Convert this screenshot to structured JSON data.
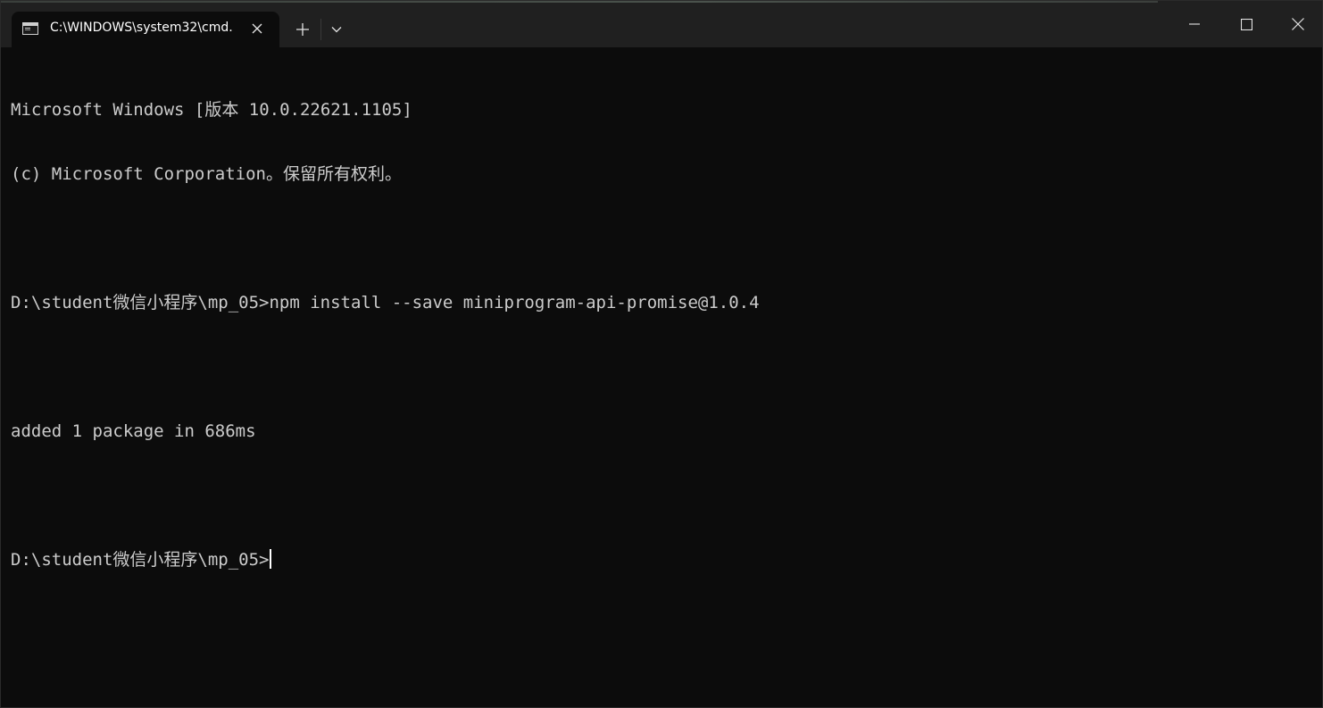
{
  "window": {
    "tab_title": "C:\\WINDOWS\\system32\\cmd.",
    "tab_icon": "terminal-icon",
    "new_tab_icon": "plus-icon",
    "dropdown_icon": "chevron-down-icon",
    "close_tab_icon": "close-icon"
  },
  "controls": {
    "minimize_icon": "minimize-icon",
    "maximize_icon": "maximize-icon",
    "close_icon": "close-icon"
  },
  "terminal": {
    "lines": [
      "Microsoft Windows [版本 10.0.22621.1105]",
      "(c) Microsoft Corporation。保留所有权利。",
      "",
      "D:\\student微信小程序\\mp_05>npm install --save miniprogram-api-promise@1.0.4",
      "",
      "added 1 package in 686ms",
      "",
      "D:\\student微信小程序\\mp_05>"
    ]
  },
  "colors": {
    "background": "#0c0c0c",
    "titlebar": "#202020",
    "text": "#cccccc"
  }
}
